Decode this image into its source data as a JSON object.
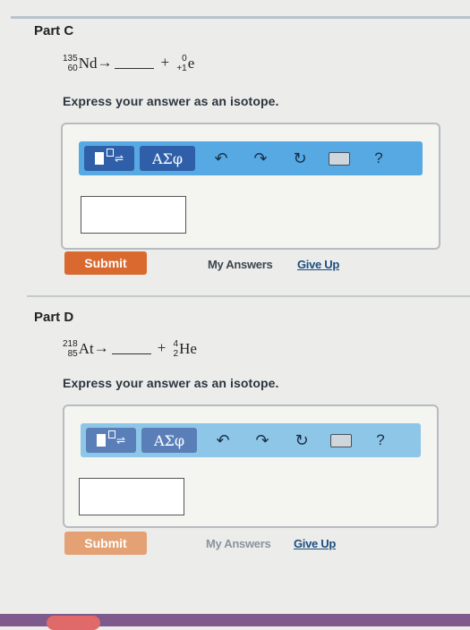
{
  "partC": {
    "title": "Part C",
    "eq": {
      "reactant_mass": "135",
      "reactant_atomic": "60",
      "reactant_symbol": "Nd",
      "arrow": "→",
      "plus": "+",
      "product_mass": "0",
      "product_atomic": "+1",
      "product_symbol": "e"
    },
    "instruction": "Express your answer as an isotope.",
    "toolbar": {
      "greek": "ΑΣφ",
      "help": "?"
    },
    "answer_value": "",
    "submit": "Submit",
    "my_answers": "My Answers",
    "give_up": "Give Up"
  },
  "partD": {
    "title": "Part D",
    "eq": {
      "reactant_mass": "218",
      "reactant_atomic": "85",
      "reactant_symbol": "At",
      "arrow": "→",
      "plus": "+",
      "product_mass": "4",
      "product_atomic": "2",
      "product_symbol": "He"
    },
    "instruction": "Express your answer as an isotope.",
    "toolbar": {
      "greek": "ΑΣφ",
      "help": "?"
    },
    "answer_value": "",
    "submit": "Submit",
    "my_answers": "My Answers",
    "give_up": "Give Up"
  },
  "icons": [
    "template-icon",
    "undo-icon",
    "redo-icon",
    "reset-icon",
    "keyboard-icon",
    "help-icon"
  ],
  "colors": {
    "toolbar": "#56a9e2",
    "toolbar_button": "#2f5fa8",
    "submit": "#d9692f"
  }
}
